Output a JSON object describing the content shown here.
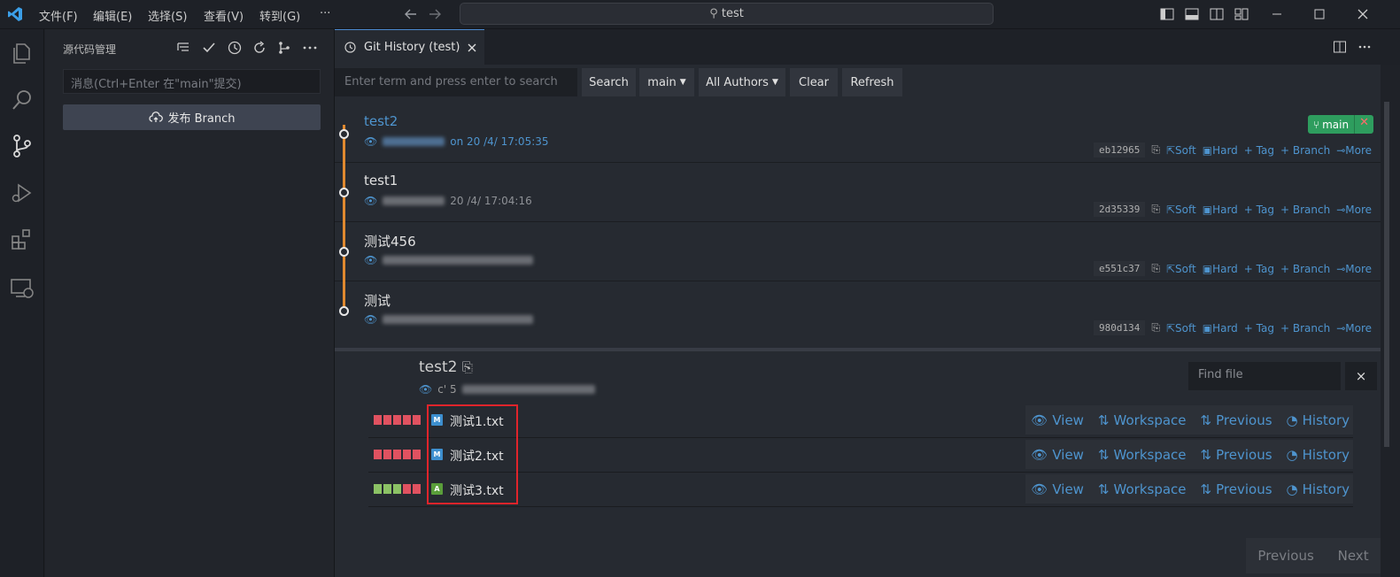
{
  "titlebar": {
    "menus": [
      "文件(F)",
      "编辑(E)",
      "选择(S)",
      "查看(V)",
      "转到(G)"
    ],
    "more": "···",
    "search_text": "test"
  },
  "sidebar": {
    "title": "源代码管理",
    "commit_placeholder": "消息(Ctrl+Enter 在\"main\"提交)",
    "publish_label": "发布 Branch"
  },
  "tab": {
    "label": "Git History (test)"
  },
  "toolbar": {
    "search_placeholder": "Enter term and press enter to search",
    "search_label": "Search",
    "branch_label": "main",
    "authors_label": "All Authors",
    "clear_label": "Clear",
    "refresh_label": "Refresh"
  },
  "commits": [
    {
      "title": "test2",
      "meta_visible": "on 20 /4/ 17:05:35",
      "hash": "eb12965",
      "branch_badge": "main",
      "highlight": true
    },
    {
      "title": "test1",
      "meta_visible": "20 /4/ 17:04:16",
      "hash": "2d35339",
      "highlight": false
    },
    {
      "title": "测试456",
      "meta_visible": "",
      "hash": "e551c37",
      "highlight": false
    },
    {
      "title": "测试",
      "meta_visible": "",
      "hash": "980d134",
      "highlight": false
    }
  ],
  "commit_actions": {
    "soft": "Soft",
    "hard": "Hard",
    "tag": "Tag",
    "branch": "Branch",
    "more": "More"
  },
  "details": {
    "title": "test2",
    "meta_visible": "c' 5",
    "find_placeholder": "Find file",
    "close": "×",
    "files": [
      {
        "name": "测试1.txt",
        "status": "M",
        "bars": [
          "#e05260",
          "#e05260",
          "#e05260",
          "#e05260",
          "#e05260"
        ]
      },
      {
        "name": "测试2.txt",
        "status": "M",
        "bars": [
          "#e05260",
          "#e05260",
          "#e05260",
          "#e05260",
          "#e05260"
        ]
      },
      {
        "name": "测试3.txt",
        "status": "A",
        "bars": [
          "#8cc265",
          "#8cc265",
          "#8cc265",
          "#e05260",
          "#e05260"
        ]
      }
    ],
    "file_actions": {
      "view": "View",
      "workspace": "Workspace",
      "previous": "Previous",
      "history": "History"
    },
    "pager": {
      "previous": "Previous",
      "next": "Next"
    }
  },
  "colors": {
    "accent": "#4e94ce",
    "graph": "#e0892f",
    "badge": "#2e9d5e",
    "modified": "#3d8fcf",
    "added": "#5a9e3a"
  }
}
